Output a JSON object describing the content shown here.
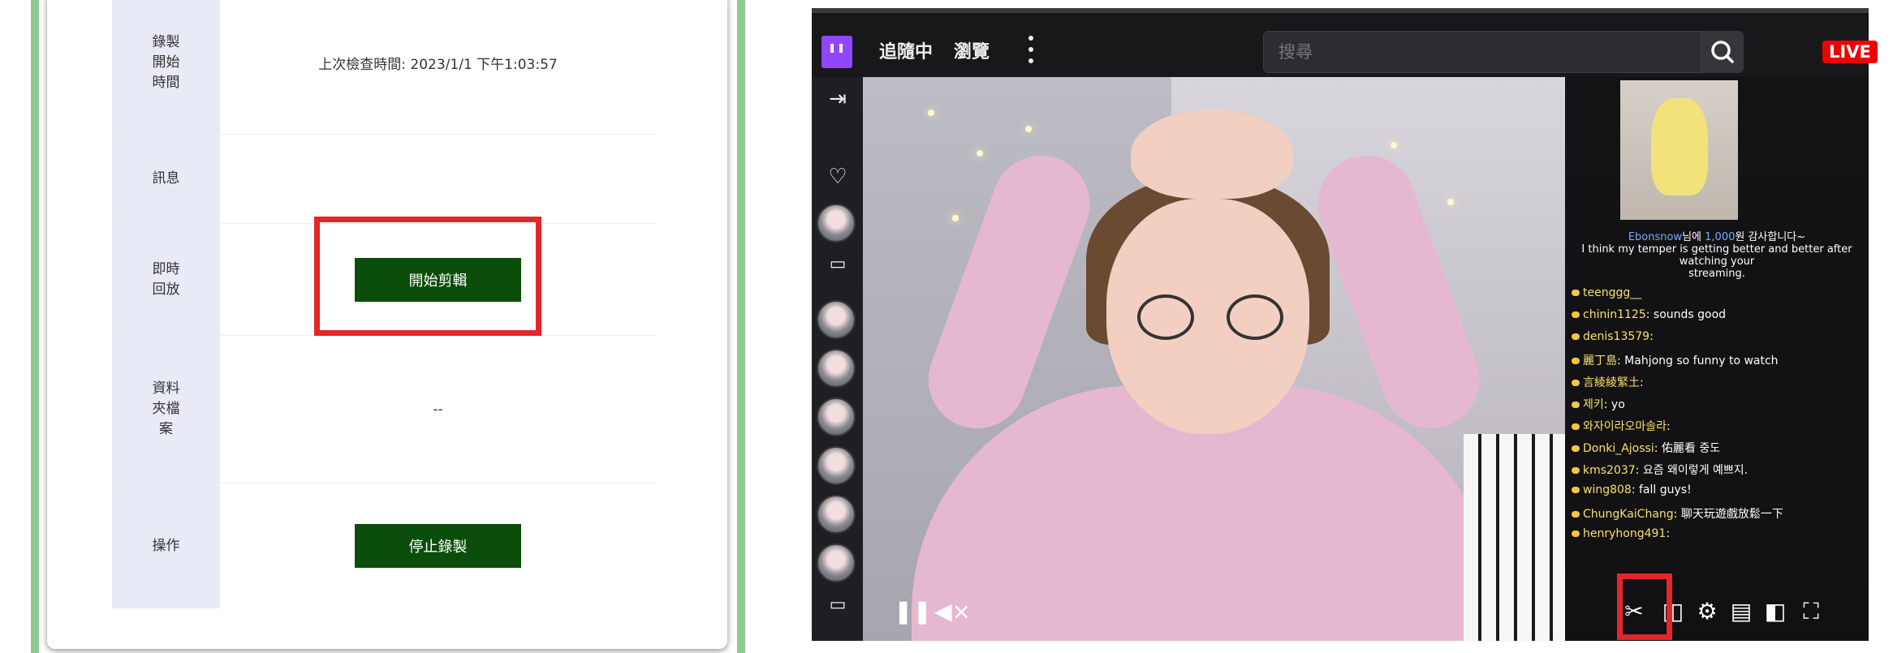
{
  "left": {
    "rows": [
      {
        "label_lines": [
          "錄製",
          "開始",
          "時間"
        ],
        "value": "上次檢查時間: 2023/1/1 下午1:03:57"
      },
      {
        "label_lines": [
          "訊息"
        ],
        "value": ""
      },
      {
        "label_lines": [
          "即時",
          "回放"
        ],
        "button": "開始剪輯"
      },
      {
        "label_lines": [
          "資料",
          "夾檔",
          "案"
        ],
        "value": "--"
      },
      {
        "label_lines": [
          "操作"
        ],
        "button": "停止錄製"
      }
    ]
  },
  "twitch": {
    "nav": {
      "following": "追隨中",
      "browse": "瀏覽"
    },
    "search": {
      "placeholder": "搜尋"
    },
    "live_badge": "LIVE",
    "chat_banner": {
      "line1_user": "Ebonsnow",
      "line1_mid": "님에 ",
      "line1_amount": "1,000",
      "line1_end": "원 감사합니다~",
      "line2": "I think my temper is getting better and better after watching your",
      "line3": "streaming."
    },
    "chat": [
      {
        "user": "teenggg__",
        "msg": ""
      },
      {
        "user": "chinin1125",
        "msg": ": sounds good"
      },
      {
        "user": "denis13579",
        "msg": ": "
      },
      {
        "user": "麗丁島",
        "msg": ": Mahjong so funny to watch"
      },
      {
        "user": "言綾綾緊土",
        "msg": ": "
      },
      {
        "user": "제키",
        "msg": ": yo"
      },
      {
        "user": "와자이라오마솔라",
        "msg": ": "
      },
      {
        "user": "Donki_Ajossi",
        "msg": ": 佑麗看 중도"
      },
      {
        "user": "kms2037",
        "msg": ": 요즘 왜이렇게 예쁘지."
      },
      {
        "user": "wing808",
        "msg": ": fall guys!"
      },
      {
        "user": "ChungKaiChang",
        "msg": ": 聊天玩遊戲放鬆一下"
      },
      {
        "user": "henryhong491",
        "msg": ": "
      }
    ]
  }
}
